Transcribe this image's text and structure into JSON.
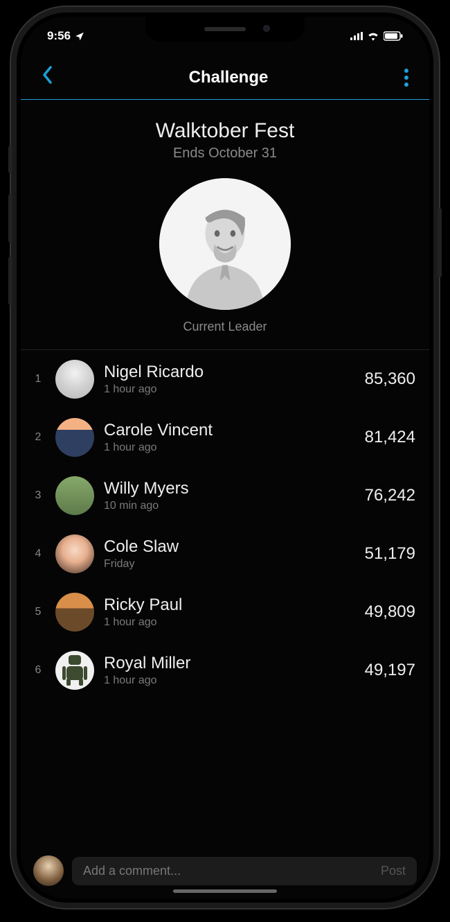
{
  "status": {
    "time": "9:56"
  },
  "nav": {
    "title": "Challenge"
  },
  "challenge": {
    "name": "Walktober Fest",
    "ends": "Ends October 31",
    "leader_label": "Current Leader"
  },
  "participants": [
    {
      "rank": "1",
      "name": "Nigel Ricardo",
      "sub": "1 hour ago",
      "score": "85,360"
    },
    {
      "rank": "2",
      "name": "Carole Vincent",
      "sub": "1 hour ago",
      "score": "81,424"
    },
    {
      "rank": "3",
      "name": "Willy Myers",
      "sub": "10 min ago",
      "score": "76,242"
    },
    {
      "rank": "4",
      "name": "Cole Slaw",
      "sub": "Friday",
      "score": "51,179"
    },
    {
      "rank": "5",
      "name": "Ricky Paul",
      "sub": "1 hour ago",
      "score": "49,809"
    },
    {
      "rank": "6",
      "name": "Royal Miller",
      "sub": "1 hour ago",
      "score": "49,197"
    }
  ],
  "comment": {
    "placeholder": "Add a comment...",
    "post_label": "Post"
  }
}
